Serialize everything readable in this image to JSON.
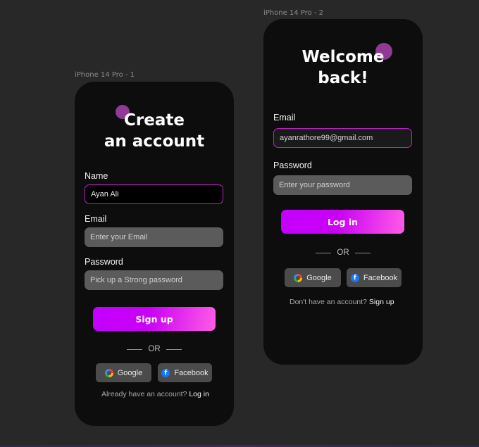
{
  "frames": {
    "signup_label": "iPhone 14 Pro - 1",
    "login_label": "iPhone 14 Pro - 2"
  },
  "signup": {
    "title_line1": "Create",
    "title_line2": "an account",
    "name_label": "Name",
    "name_value": "Ayan Ali",
    "email_label": "Email",
    "email_placeholder": "Enter your Email",
    "password_label": "Password",
    "password_placeholder": "Pick up a Strong password",
    "submit_label": "Sign up",
    "divider_text": "OR",
    "google_label": "Google",
    "facebook_label": "Facebook",
    "footer_text": "Already have an account?",
    "footer_link": "Log in"
  },
  "login": {
    "title_line1": "Welcome",
    "title_line2": "back!",
    "email_label": "Email",
    "email_value": "ayanrathore99@gmail.com",
    "password_label": "Password",
    "password_placeholder": "Enter your password",
    "submit_label": "Log in",
    "divider_text": "OR",
    "google_label": "Google",
    "facebook_label": "Facebook",
    "footer_text": "Don't have an account?",
    "footer_link": "Sign up"
  },
  "icons": {
    "google": "google-icon",
    "facebook": "facebook-icon",
    "facebook_glyph": "f"
  },
  "colors": {
    "accent": "#c21ec7",
    "cta_start": "#c300ff",
    "cta_end": "#ff5ce6",
    "blob": "#8f3a93",
    "canvas": "#282828",
    "phone": "#0d0d0d"
  }
}
